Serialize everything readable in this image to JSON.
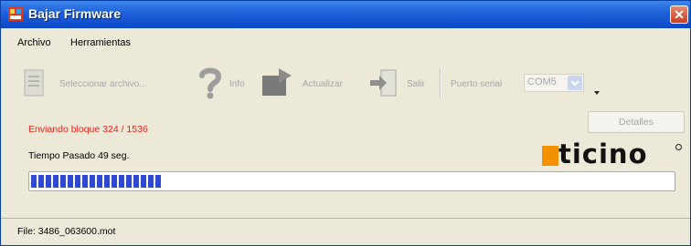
{
  "window": {
    "title": "Bajar Firmware",
    "close_glyph": "✕"
  },
  "menu": {
    "items": [
      {
        "label": "Archivo"
      },
      {
        "label": "Herramientas"
      }
    ]
  },
  "toolbar": {
    "select_file": {
      "label": "Seleccionar archivo...",
      "icon": "document-icon"
    },
    "info": {
      "label": "Info",
      "icon": "question-icon"
    },
    "update": {
      "label": "Actualizar",
      "icon": "upload-icon"
    },
    "exit": {
      "label": "Salir",
      "icon": "exit-door-icon"
    },
    "port": {
      "label": "Puerto serial",
      "value": "COM5"
    }
  },
  "status": {
    "sending": "Enviando bloque 324 / 1536",
    "elapsed": "Tiempo Pasado 49 seg.",
    "details_button": "Detalles"
  },
  "progress": {
    "fraction": 0.21,
    "color": "#2f4bd5"
  },
  "logo": {
    "text": "bticino",
    "accent": "#f39200"
  },
  "statusbar": {
    "file": "File: 3486_063600.mot"
  },
  "colors": {
    "sending_text": "#e8231a",
    "title_bar": "#1e5fd8"
  }
}
